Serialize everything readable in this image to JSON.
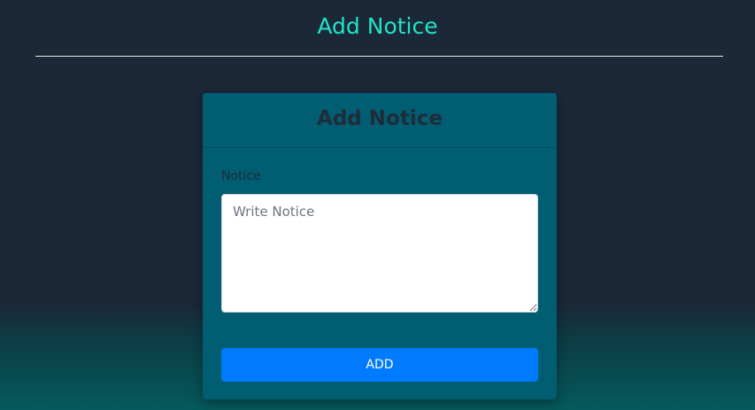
{
  "page": {
    "title": "Add Notice"
  },
  "card": {
    "title": "Add Notice",
    "notice_label": "Notice",
    "notice_placeholder": "Write Notice",
    "notice_value": "",
    "add_button_label": "ADD"
  },
  "colors": {
    "page_background": "#1b2838",
    "title_accent": "#22e2c8",
    "card_background": "#015d72",
    "button_primary": "#007bff"
  }
}
